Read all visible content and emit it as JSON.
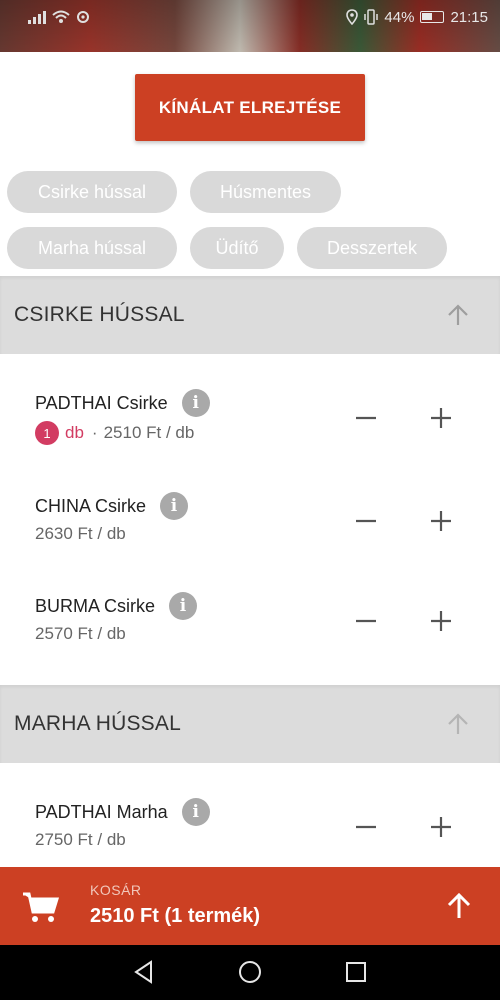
{
  "status_bar": {
    "battery": "44%",
    "time": "21:15"
  },
  "toggle_button_label": "KÍNÁLAT ELREJTÉSE",
  "categories": [
    "Csirke hússal",
    "Húsmentes",
    "Marha hússal",
    "Üdítő",
    "Desszertek"
  ],
  "sections": [
    {
      "title": "CSIRKE HÚSSAL",
      "items": [
        {
          "name": "PADTHAI Csirke",
          "qty": "1",
          "qty_unit": "db",
          "separator": "·",
          "price": "2510 Ft / db"
        },
        {
          "name": "CHINA Csirke",
          "price": "2630 Ft / db"
        },
        {
          "name": "BURMA Csirke",
          "price": "2570 Ft / db"
        }
      ]
    },
    {
      "title": "MARHA HÚSSAL",
      "items": [
        {
          "name": "PADTHAI Marha",
          "price": "2750 Ft / db"
        }
      ]
    }
  ],
  "cart": {
    "label": "KOSÁR",
    "total": "2510 Ft (1 termék)"
  },
  "colors": {
    "accent": "#cc4023",
    "chip_bg": "#d9d9d9",
    "badge": "#d23c62",
    "section_bg": "#dcdcdc"
  },
  "icons": [
    "cart-icon",
    "info-icon",
    "arrow-up-icon",
    "minus-icon",
    "plus-icon",
    "nav-back-icon",
    "nav-home-icon",
    "nav-recents-icon"
  ]
}
